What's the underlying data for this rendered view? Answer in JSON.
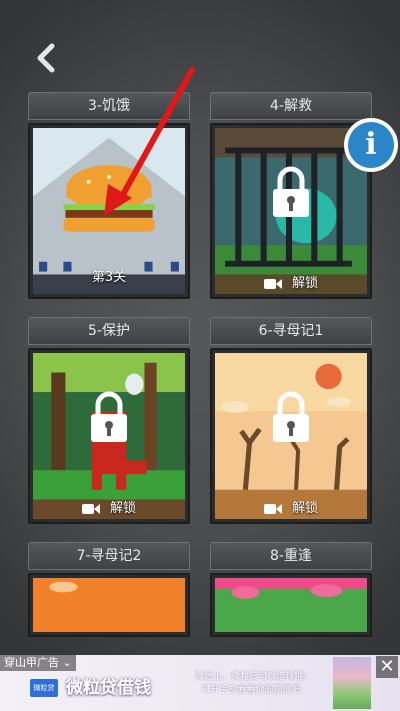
{
  "nav": {
    "back_icon": "chevron-left-icon",
    "info_label": "i"
  },
  "levels": [
    {
      "title": "3-饥饿",
      "status": "第3关",
      "locked": false
    },
    {
      "title": "4-解救",
      "status": "解锁",
      "locked": true
    },
    {
      "title": "5-保护",
      "status": "解锁",
      "locked": true
    },
    {
      "title": "6-寻母记1",
      "status": "解锁",
      "locked": true
    },
    {
      "title": "7-寻母记2",
      "status": "",
      "locked": true
    },
    {
      "title": "8-重逢",
      "status": "",
      "locked": true
    }
  ],
  "ad": {
    "source": "穿山甲广告",
    "logo_text": "微粒贷",
    "title": "微粒贷借钱",
    "desc_line1": "微信上，微粒贷可以借钱啦!",
    "desc_line2": "打开手机看看你的额度吧",
    "close_label": "✕"
  },
  "colors": {
    "accent_arrow": "#e01818",
    "info_blue": "#2b86c9"
  }
}
